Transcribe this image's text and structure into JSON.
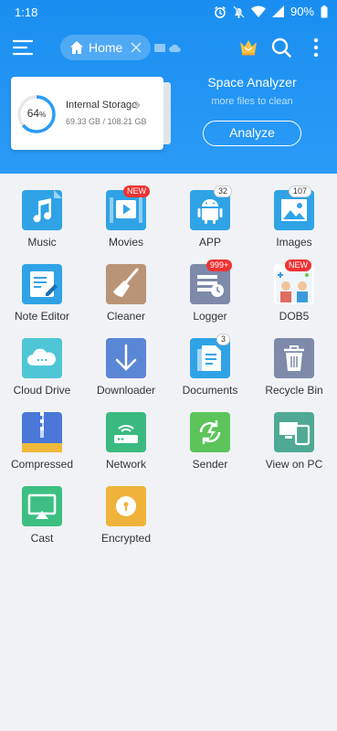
{
  "status": {
    "time": "1:18",
    "battery": "90%"
  },
  "toolbar": {
    "home_label": "Home"
  },
  "storage": {
    "percent": "64",
    "percent_sign": "%",
    "title": "Internal Storage",
    "usage": "69.33 GB / 108.21 GB",
    "fraction": 0.64
  },
  "analyzer": {
    "title": "Space Analyzer",
    "subtitle": "more files to clean",
    "button": "Analyze"
  },
  "tiles": [
    {
      "label": "Music"
    },
    {
      "label": "Movies",
      "badge": "NEW"
    },
    {
      "label": "APP",
      "badge": "32"
    },
    {
      "label": "Images",
      "badge": "107"
    },
    {
      "label": "Note Editor"
    },
    {
      "label": "Cleaner"
    },
    {
      "label": "Logger",
      "badge": "999+"
    },
    {
      "label": "DOB5",
      "badge": "NEW"
    },
    {
      "label": "Cloud Drive"
    },
    {
      "label": "Downloader"
    },
    {
      "label": "Documents",
      "badge": "3"
    },
    {
      "label": "Recycle Bin"
    },
    {
      "label": "Compressed"
    },
    {
      "label": "Network"
    },
    {
      "label": "Sender"
    },
    {
      "label": "View on PC"
    },
    {
      "label": "Cast"
    },
    {
      "label": "Encrypted"
    }
  ],
  "colors": {
    "header": "#1a8ef0",
    "badge_red": "#ee3333"
  }
}
